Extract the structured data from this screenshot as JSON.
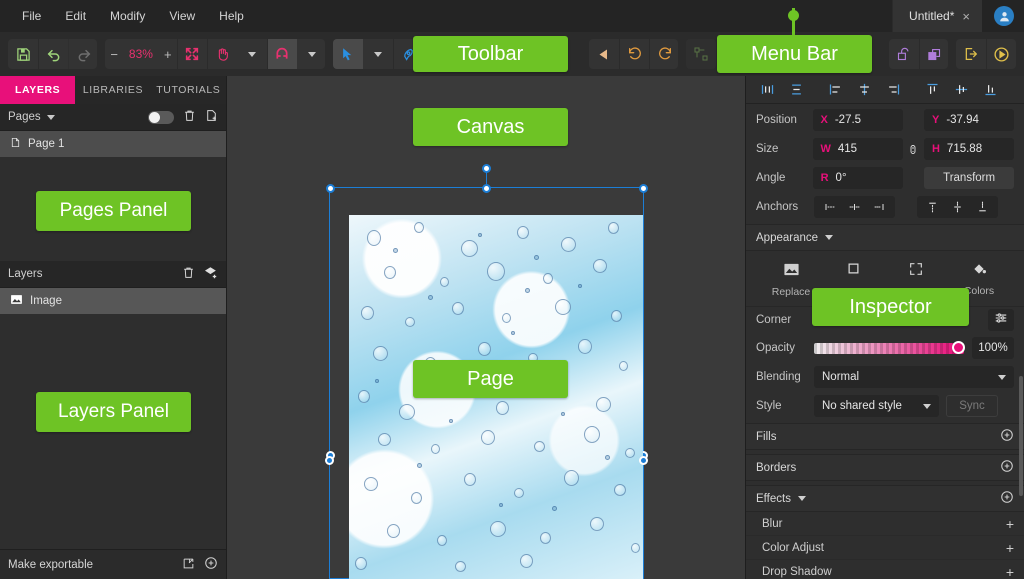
{
  "app": {
    "accent_pink": "#e8107a",
    "accent_green": "#6ec325",
    "accent_blue": "#1c7ed6",
    "bg_dark": "#2b2b2b"
  },
  "menubar": {
    "items": [
      {
        "label": "File"
      },
      {
        "label": "Edit"
      },
      {
        "label": "Modify"
      },
      {
        "label": "View"
      },
      {
        "label": "Help"
      }
    ],
    "document_tab": {
      "title": "Untitled*",
      "close": "×"
    },
    "avatar_icon": "user-avatar-icon"
  },
  "toolbar": {
    "save_icon": "save-icon",
    "undo_icon": "undo-icon",
    "redo_icon": "redo-icon",
    "zoom_out": "−",
    "zoom_level": "83%",
    "zoom_in": "+",
    "fit_icon": "fit-to-screen-icon",
    "hand_icon": "hand-tool-icon",
    "hand_caret": "chevron-down-icon",
    "snap_icon": "magnet-snap-icon",
    "snap_caret": "chevron-down-icon",
    "cursor_icon": "cursor-tool-icon",
    "cursor_caret": "chevron-down-icon",
    "pen_icon": "pen-tool-icon",
    "flip_icon": "flip-horizontal-icon",
    "rotate_left_icon": "rotate-left-icon",
    "rotate_right_icon": "rotate-right-icon",
    "group_icon": "group-objects-icon",
    "unlock_icon": "unlock-icon",
    "duplicate_icon": "duplicate-icon",
    "export_icon": "export-icon",
    "preview_icon": "preview-play-icon"
  },
  "left_panel": {
    "tabs": [
      {
        "label": "LAYERS",
        "active": true
      },
      {
        "label": "LIBRARIES",
        "active": false
      },
      {
        "label": "TUTORIALS",
        "active": false
      }
    ],
    "pages": {
      "header_label": "Pages",
      "header_caret": "chevron-down-icon",
      "toggle": "visibility-toggle",
      "delete_icon": "trash-icon",
      "add_icon": "add-page-icon",
      "items": [
        {
          "label": "Page 1",
          "icon": "page-icon",
          "selected": true
        }
      ]
    },
    "layers": {
      "header_label": "Layers",
      "delete_icon": "trash-icon",
      "add_icon": "add-layer-icon",
      "items": [
        {
          "label": "Image",
          "icon": "image-thumbnail-icon",
          "selected": true
        }
      ]
    },
    "footer": {
      "label": "Make exportable",
      "settings_icon": "export-settings-icon",
      "add_icon": "plus-circle-icon"
    }
  },
  "canvas": {
    "artwork_alt": "water-droplets-image",
    "selection": {
      "handles": 8,
      "rotation_handle": "rotation-handle"
    }
  },
  "inspector": {
    "align_horizontal": [
      "distribute-horizontal-icon",
      "distribute-vertical-icon"
    ],
    "align_group2": [
      "align-left-icon",
      "align-center-horizontal-icon",
      "align-right-icon"
    ],
    "align_group3": [
      "align-top-icon",
      "align-center-vertical-icon",
      "align-bottom-icon"
    ],
    "position": {
      "label": "Position",
      "x_axis": "X",
      "x_value": "-27.5",
      "y_axis": "Y",
      "y_value": "-37.94"
    },
    "size": {
      "label": "Size",
      "w_axis": "W",
      "w_value": "415",
      "h_axis": "H",
      "h_value": "715.88",
      "link_icon": "link-aspect-ratio-icon"
    },
    "angle": {
      "label": "Angle",
      "r_axis": "R",
      "r_value": "0°",
      "transform_label": "Transform"
    },
    "anchors": {
      "label": "Anchors",
      "horizontal": [
        "anchor-left-icon",
        "anchor-center-horizontal-icon",
        "anchor-right-icon"
      ],
      "vertical": [
        "anchor-top-icon",
        "anchor-center-vertical-icon",
        "anchor-bottom-icon"
      ]
    },
    "appearance": {
      "label": "Appearance",
      "caret": "chevron-down-icon",
      "actions": [
        {
          "label": "Replace",
          "icon": "replace-image-icon"
        },
        {
          "label": "",
          "icon": "crop-square-icon"
        },
        {
          "label": "",
          "icon": "resize-fit-icon"
        },
        {
          "label": "Colors",
          "icon": "paint-bucket-icon"
        }
      ],
      "corner_label": "Corner",
      "corner_settings_icon": "sliders-icon"
    },
    "opacity": {
      "label": "Opacity",
      "value": "100%",
      "percent": 100
    },
    "blending": {
      "label": "Blending",
      "value": "Normal",
      "caret": "chevron-down-icon"
    },
    "style": {
      "label": "Style",
      "value": "No shared style",
      "caret": "chevron-down-icon",
      "sync_label": "Sync"
    },
    "sections": [
      {
        "label": "Fills",
        "add_icon": "plus-circle-icon",
        "expanded": false
      },
      {
        "label": "Borders",
        "add_icon": "plus-circle-icon",
        "expanded": false
      },
      {
        "label": "Effects",
        "add_icon": "plus-circle-icon",
        "expanded": true
      }
    ],
    "effects": [
      {
        "label": "Blur",
        "add": "+"
      },
      {
        "label": "Color Adjust",
        "add": "+"
      },
      {
        "label": "Drop Shadow",
        "add": "+"
      }
    ]
  },
  "annotations": [
    {
      "label": "Toolbar"
    },
    {
      "label": "Menu Bar"
    },
    {
      "label": "Canvas"
    },
    {
      "label": "Pages Panel"
    },
    {
      "label": "Layers Panel"
    },
    {
      "label": "Page"
    },
    {
      "label": "Inspector"
    }
  ]
}
